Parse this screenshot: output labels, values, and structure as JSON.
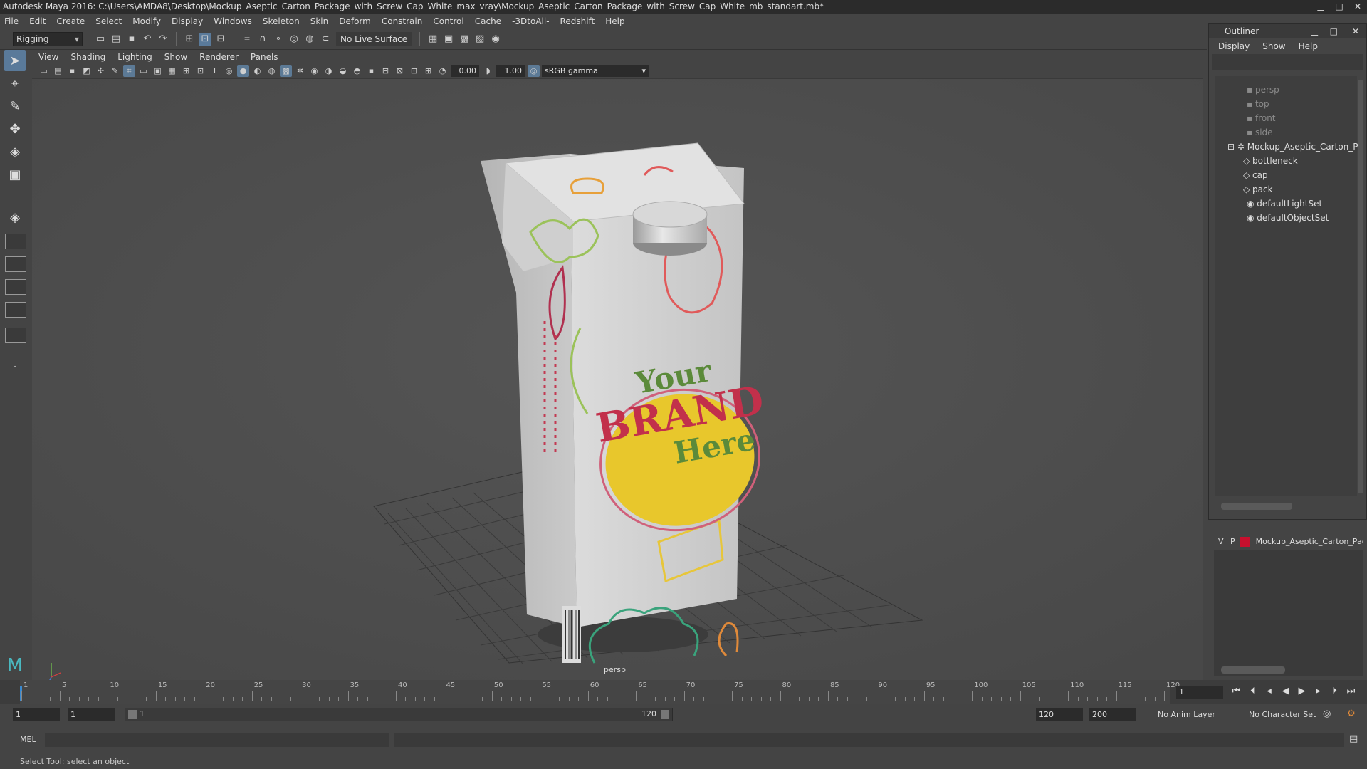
{
  "window": {
    "title": "Autodesk Maya 2016: C:\\Users\\AMDA8\\Desktop\\Mockup_Aseptic_Carton_Package_with_Screw_Cap_White_max_vray\\Mockup_Aseptic_Carton_Package_with_Screw_Cap_White_mb_standart.mb*"
  },
  "menubar": [
    "File",
    "Edit",
    "Create",
    "Select",
    "Modify",
    "Display",
    "Windows",
    "Skeleton",
    "Skin",
    "Deform",
    "Constrain",
    "Control",
    "Cache",
    "-3DtoAll-",
    "Redshift",
    "Help"
  ],
  "statusline": {
    "mode": "Rigging",
    "live_surface": "No Live Surface"
  },
  "panel": {
    "menus": [
      "View",
      "Shading",
      "Lighting",
      "Show",
      "Renderer",
      "Panels"
    ],
    "exposure": "0.00",
    "gamma": "1.00",
    "color_space": "sRGB gamma",
    "camera_label": "persp"
  },
  "carton": {
    "brand_line1": "Your",
    "brand_line2": "BRAND",
    "brand_line3": "Here"
  },
  "timeline": {
    "ticks": [
      "1",
      "5",
      "10",
      "15",
      "20",
      "25",
      "30",
      "35",
      "40",
      "45",
      "50",
      "55",
      "60",
      "65",
      "70",
      "75",
      "80",
      "85",
      "90",
      "95",
      "100",
      "105",
      "110",
      "115",
      "120"
    ],
    "current_frame": "1"
  },
  "range": {
    "start": "1",
    "playback_start": "1",
    "slider_start": "1",
    "slider_end": "120",
    "playback_end": "120",
    "end": "200",
    "anim_layer": "No Anim Layer",
    "character_set": "No Character Set"
  },
  "commandline": {
    "label": "MEL"
  },
  "helpline": {
    "text": "Select Tool: select an object"
  },
  "outliner": {
    "title": "Outliner",
    "menus": [
      "Display",
      "Show",
      "Help"
    ],
    "items": [
      {
        "label": "persp"
      },
      {
        "label": "top"
      },
      {
        "label": "front"
      },
      {
        "label": "side"
      },
      {
        "label": "Mockup_Aseptic_Carton_P"
      },
      {
        "label": "bottleneck"
      },
      {
        "label": "cap"
      },
      {
        "label": "pack"
      },
      {
        "label": "defaultLightSet"
      },
      {
        "label": "defaultObjectSet"
      }
    ]
  },
  "layers": {
    "v": "V",
    "p": "P",
    "name": "Mockup_Aseptic_Carton_Pac",
    "color": "#c8102e"
  }
}
